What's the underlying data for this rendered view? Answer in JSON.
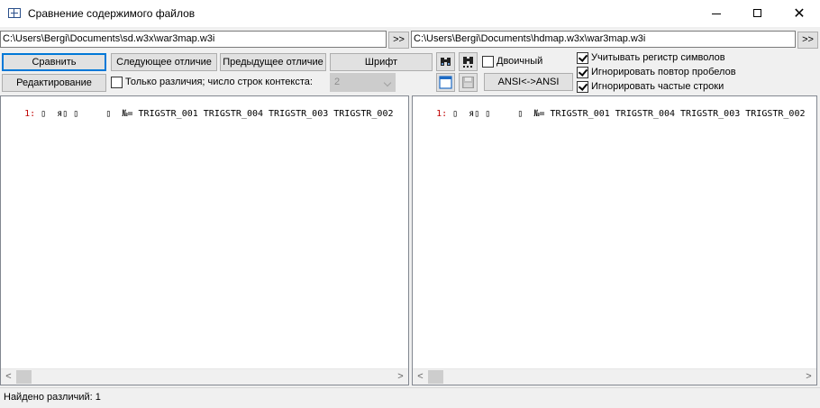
{
  "window": {
    "title": "Сравнение содержимого файлов",
    "min_glyph": "",
    "max_glyph": "",
    "close_glyph": "✕"
  },
  "files": {
    "left_path": "C:\\Users\\Bergi\\Documents\\sd.w3x\\war3map.w3i",
    "right_path": "C:\\Users\\Bergi\\Documents\\hdmap.w3x\\war3map.w3i",
    "browse_label": ">>"
  },
  "toolbar": {
    "compare": "Сравнить",
    "next_diff": "Следующее отличие",
    "prev_diff": "Предыдущее отличие",
    "font": "Шрифт",
    "edit": "Редактирование",
    "only_diffs": "Только различия; число строк контекста:",
    "context_lines": "2",
    "binary": "Двоичный",
    "ansi": "ANSI<->ANSI",
    "binary_checked": false,
    "only_diffs_checked": false
  },
  "options": {
    "case_sensitive": "Учитывать регистр символов",
    "ignore_spaces": "Игнорировать повтор пробелов",
    "ignore_frequent": "Игнорировать частые строки"
  },
  "icons": {
    "find": "binoculars-icon",
    "find_next": "binoculars-next-icon",
    "window": "window-icon",
    "save": "save-icon"
  },
  "left_pane": {
    "line_no": "1:",
    "content": " ▯  я▯ ▯     ▯  №= TRIGSTR_001 TRIGSTR_004 TRIGSTR_003 TRIGSTR_002"
  },
  "right_pane": {
    "line_no": "1:",
    "content": " ▯  я▯ ▯     ▯  №= TRIGSTR_001 TRIGSTR_004 TRIGSTR_003 TRIGSTR_002"
  },
  "scroll": {
    "left_arrow": "<",
    "right_arrow": ">"
  },
  "status": {
    "text": "Найдено различий: 1"
  }
}
